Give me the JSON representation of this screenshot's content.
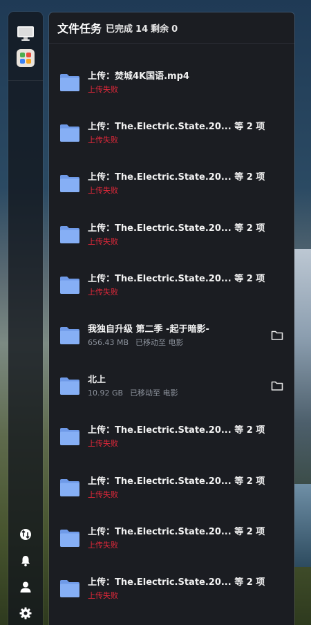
{
  "panel": {
    "title": "文件任务",
    "completed_label": "已完成",
    "completed_count": "14",
    "remaining_label": "剩余",
    "remaining_count": "0"
  },
  "tasks": [
    {
      "title": "上传：焚城4K国语.mp4",
      "status": "上传失败"
    },
    {
      "title": "上传：The.Electric.State.20... 等 2 项",
      "status": "上传失败"
    },
    {
      "title": "上传：The.Electric.State.20... 等 2 项",
      "status": "上传失败"
    },
    {
      "title": "上传：The.Electric.State.20... 等 2 项",
      "status": "上传失败"
    },
    {
      "title": "上传：The.Electric.State.20... 等 2 项",
      "status": "上传失败"
    },
    {
      "title": "我独自升级 第二季 -起于暗影-",
      "size": "656.43 MB",
      "moved": "已移动至 电影"
    },
    {
      "title": "北上",
      "size": "10.92 GB",
      "moved": "已移动至 电影"
    },
    {
      "title": "上传：The.Electric.State.20... 等 2 项",
      "status": "上传失败"
    },
    {
      "title": "上传：The.Electric.State.20... 等 2 项",
      "status": "上传失败"
    },
    {
      "title": "上传：The.Electric.State.20... 等 2 项",
      "status": "上传失败"
    },
    {
      "title": "上传：The.Electric.State.20... 等 2 项",
      "status": "上传失败"
    }
  ],
  "colors": {
    "failed": "#e1283a",
    "folder": "#7aa6f2",
    "panel_bg": "#1b1d22"
  },
  "sidebar": {
    "top_icons": [
      "monitor-icon",
      "launcher-icon"
    ],
    "bottom_icons": [
      "transfer-icon",
      "bell-icon",
      "user-icon",
      "settings-icon"
    ]
  }
}
